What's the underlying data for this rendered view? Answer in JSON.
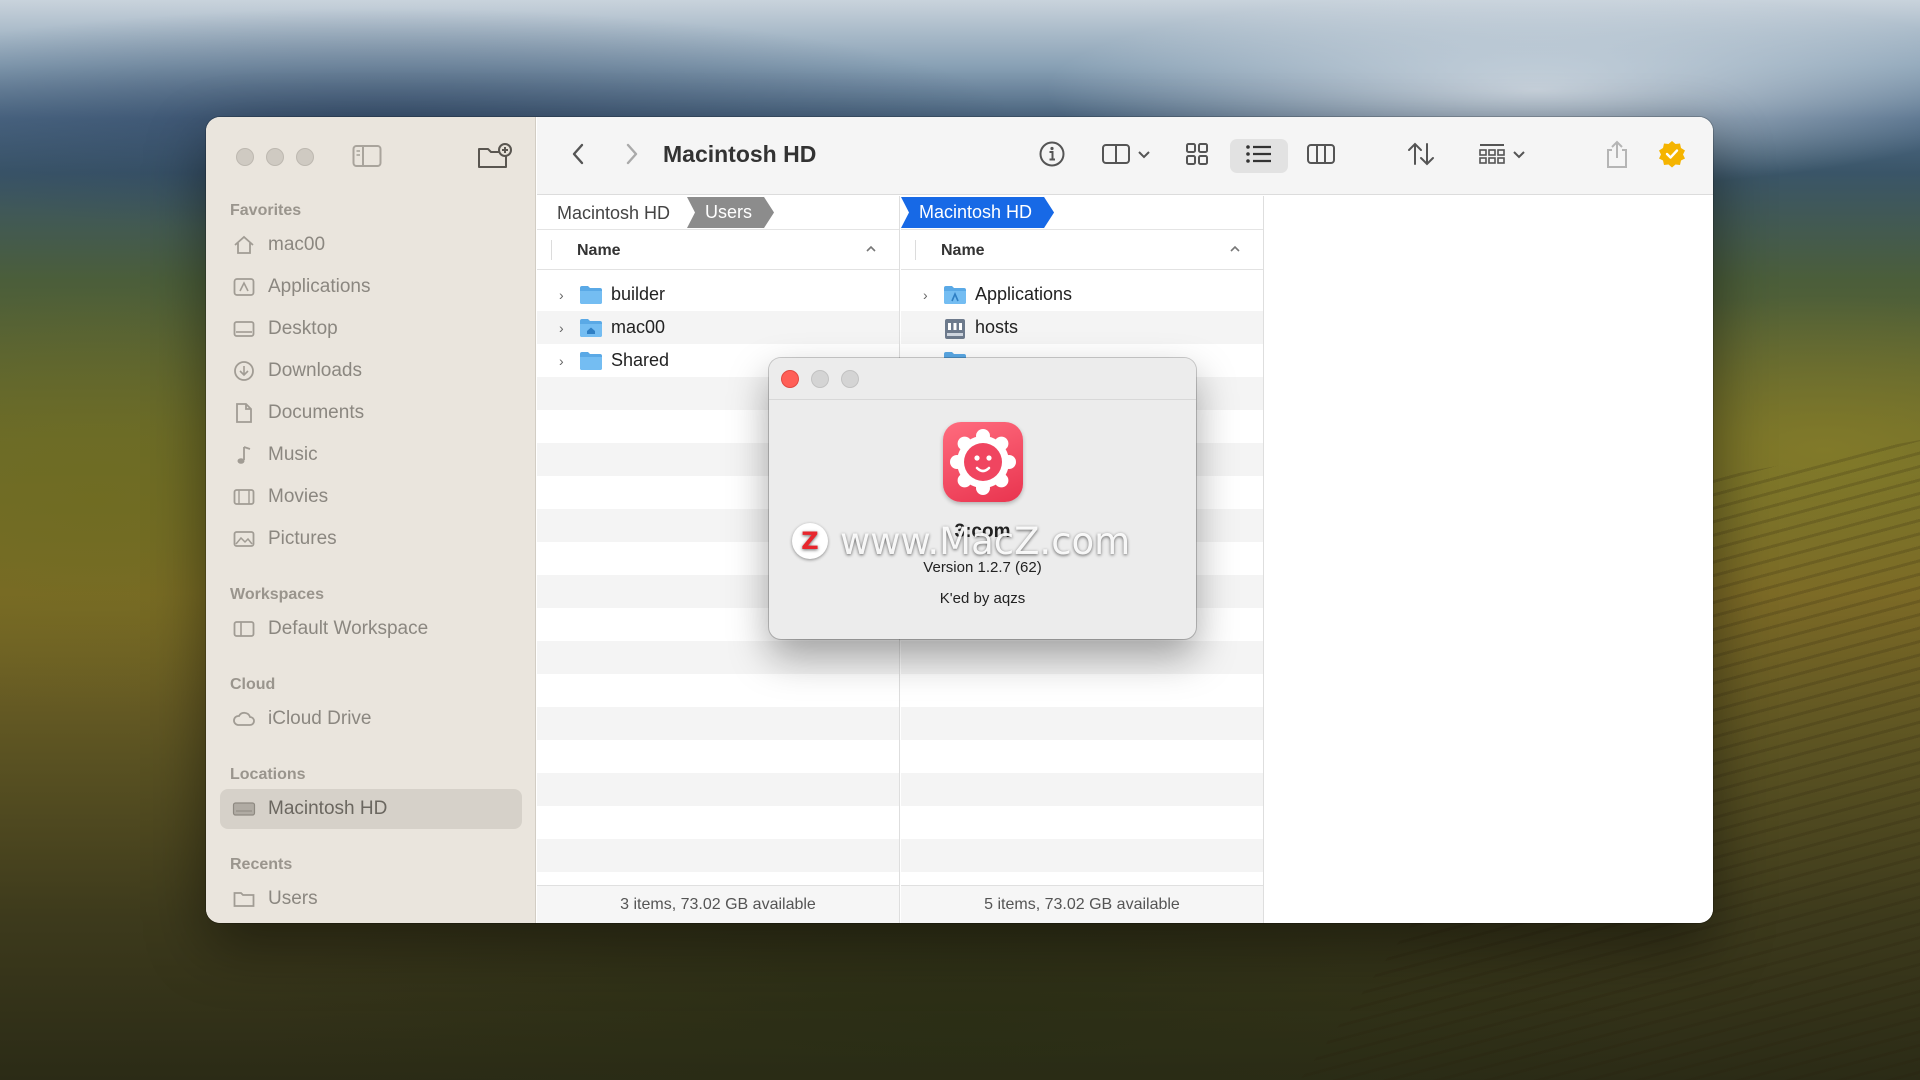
{
  "sidebar": {
    "sections": {
      "favorites": "Favorites",
      "workspaces": "Workspaces",
      "cloud": "Cloud",
      "locations": "Locations",
      "recents": "Recents"
    },
    "favorites": [
      {
        "label": "mac00",
        "icon": "home-icon"
      },
      {
        "label": "Applications",
        "icon": "applications-icon"
      },
      {
        "label": "Desktop",
        "icon": "desktop-icon"
      },
      {
        "label": "Downloads",
        "icon": "downloads-icon"
      },
      {
        "label": "Documents",
        "icon": "document-icon"
      },
      {
        "label": "Music",
        "icon": "music-icon"
      },
      {
        "label": "Movies",
        "icon": "movies-icon"
      },
      {
        "label": "Pictures",
        "icon": "pictures-icon"
      }
    ],
    "workspaces": [
      {
        "label": "Default Workspace",
        "icon": "workspace-icon"
      }
    ],
    "cloud": [
      {
        "label": "iCloud Drive",
        "icon": "cloud-icon"
      }
    ],
    "locations": [
      {
        "label": "Macintosh HD",
        "icon": "disk-icon",
        "selected": true
      }
    ],
    "recents": [
      {
        "label": "Users",
        "icon": "folder-icon"
      }
    ]
  },
  "toolbar": {
    "title": "Macintosh HD"
  },
  "column1": {
    "breadcrumb_root": "Macintosh HD",
    "breadcrumb_current": "Users",
    "header": "Name",
    "rows": [
      {
        "name": "builder",
        "icon": "folder-icon",
        "expandable": true
      },
      {
        "name": "mac00",
        "icon": "home-folder-icon",
        "expandable": true
      },
      {
        "name": "Shared",
        "icon": "folder-icon",
        "expandable": true
      }
    ],
    "status": "3 items, 73.02 GB available"
  },
  "column2": {
    "breadcrumb_current": "Macintosh HD",
    "header": "Name",
    "rows": [
      {
        "name": "Applications",
        "icon": "applications-folder-icon",
        "expandable": true
      },
      {
        "name": "hosts",
        "icon": "hosts-file-icon",
        "expandable": false
      }
    ],
    "status": "5 items, 73.02 GB available"
  },
  "about": {
    "app_name": "3:com",
    "version": "Version 1.2.7 (62)",
    "credit": "K'ed by aqzs"
  },
  "watermark": {
    "text": "www.MacZ.com",
    "badge": "Z"
  },
  "colors": {
    "accent_blue": "#1769e6",
    "close_red": "#ff5f57",
    "verified_yellow": "#f5b400",
    "app_icon_red": "#e9344f"
  }
}
